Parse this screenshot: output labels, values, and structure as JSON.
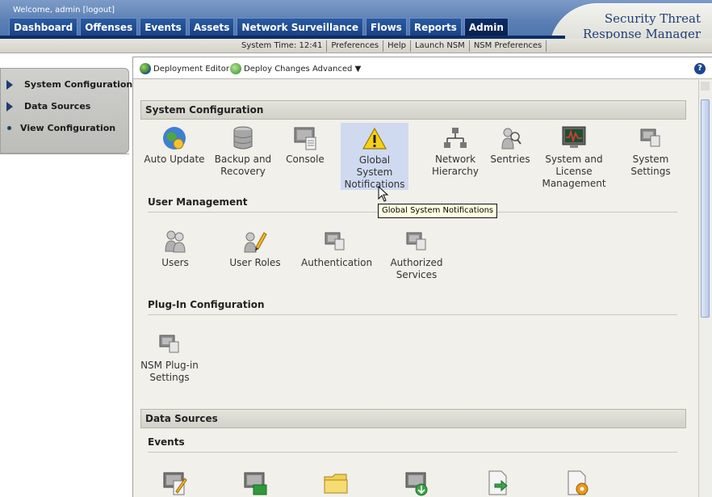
{
  "header": {
    "welcome": "Welcome, admin [logout]",
    "nav_tabs": [
      "Dashboard",
      "Offenses",
      "Events",
      "Assets",
      "Network Surveillance",
      "Flows",
      "Reports",
      "Admin"
    ],
    "active_tab": "Admin",
    "util": [
      "System Time: 12:41",
      "Preferences",
      "Help",
      "Launch NSM",
      "NSM Preferences"
    ],
    "brand_line1": "Security Threat",
    "brand_line2": "Response Manager"
  },
  "sidebar": {
    "items": [
      {
        "label": "System Configuration",
        "marker": "triangle"
      },
      {
        "label": "Data Sources",
        "marker": "triangle"
      },
      {
        "label": "View Configuration",
        "marker": "dot"
      }
    ]
  },
  "toolbar": {
    "deployment_editor": "Deployment Editor",
    "deploy_changes": "Deploy Changes",
    "advanced": "Advanced ▼",
    "help": "?"
  },
  "sections": {
    "system_configuration": "System Configuration",
    "user_management": "User Management",
    "plugin_configuration": "Plug-In Configuration",
    "data_sources": "Data Sources",
    "events": "Events"
  },
  "system_tiles": [
    {
      "label": "Auto Update",
      "icon": "globe-update-icon"
    },
    {
      "label": "Backup and Recovery",
      "icon": "database-icon"
    },
    {
      "label": "Console",
      "icon": "console-icon"
    },
    {
      "label": "Global System Notifications",
      "icon": "warning-icon"
    },
    {
      "label": "Network Hierarchy",
      "icon": "network-hierarchy-icon"
    },
    {
      "label": "Sentries",
      "icon": "sentries-icon"
    },
    {
      "label": "System and License Management",
      "icon": "monitor-graph-icon"
    },
    {
      "label": "System Settings",
      "icon": "system-settings-icon"
    }
  ],
  "user_tiles": [
    {
      "label": "Users",
      "icon": "users-icon"
    },
    {
      "label": "User Roles",
      "icon": "user-roles-icon"
    },
    {
      "label": "Authentication",
      "icon": "authentication-icon"
    },
    {
      "label": "Authorized Services",
      "icon": "authorized-services-icon"
    }
  ],
  "plugin_tiles": [
    {
      "label": "NSM Plug-in Settings",
      "icon": "plugin-settings-icon"
    }
  ],
  "event_tiles": [
    {
      "icon": "log-source-edit-icon"
    },
    {
      "icon": "log-source-extension-icon"
    },
    {
      "icon": "folder-icon"
    },
    {
      "icon": "log-source-download-icon"
    },
    {
      "icon": "document-arrow-icon"
    },
    {
      "icon": "document-gear-icon"
    }
  ],
  "tooltip": "Global System Notifications",
  "colors": {
    "nav_active": "#0c2d66",
    "nav": "#1a4285",
    "highlight": "#cfdaf0",
    "brand": "#1e3f76"
  }
}
